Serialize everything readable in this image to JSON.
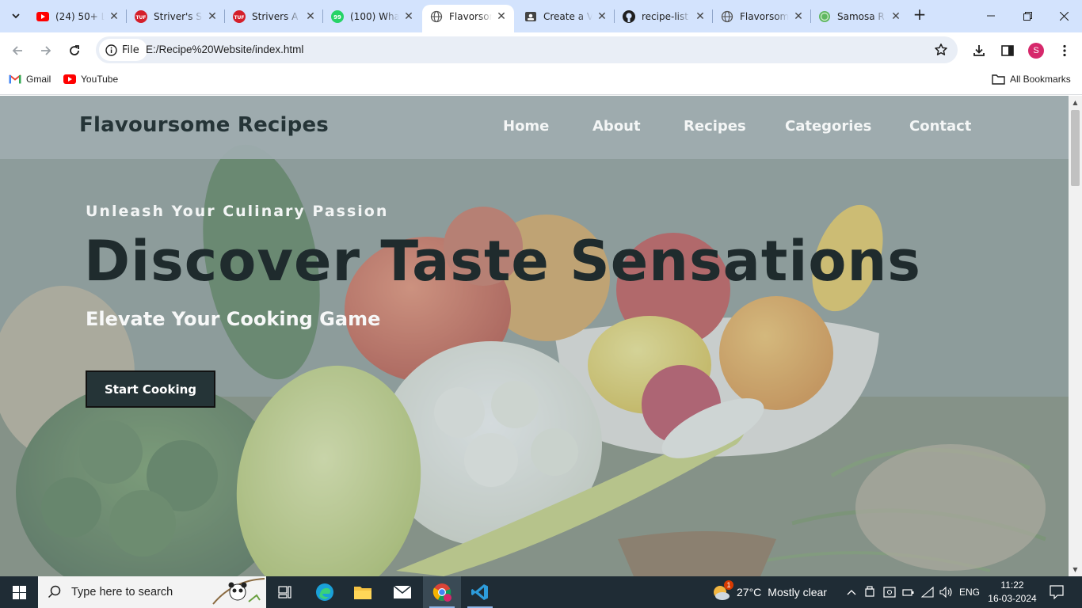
{
  "browser": {
    "tabs": [
      {
        "title": "(24) 50+ L",
        "icon": "youtube-icon"
      },
      {
        "title": "Striver's S",
        "icon": "tuf-icon"
      },
      {
        "title": "Strivers A",
        "icon": "tuf-icon"
      },
      {
        "title": "(100) Wha",
        "icon": "whatsapp-icon"
      },
      {
        "title": "Flavorsom",
        "icon": "globe-icon",
        "active": true
      },
      {
        "title": "Create a V",
        "icon": "contact-icon"
      },
      {
        "title": "recipe-list",
        "icon": "github-icon"
      },
      {
        "title": "Flavorsom",
        "icon": "globe-icon"
      },
      {
        "title": "Samosa R",
        "icon": "samosa-icon"
      }
    ],
    "address": {
      "chip_label": "File",
      "url": "E:/Recipe%20Website/index.html"
    },
    "profile_initial": "S",
    "bookmarks": [
      {
        "label": "Gmail",
        "icon": "gmail-icon"
      },
      {
        "label": "YouTube",
        "icon": "youtube-icon"
      }
    ],
    "all_bookmarks_label": "All Bookmarks"
  },
  "site": {
    "brand": "Flavoursome Recipes",
    "nav": [
      "Home",
      "About",
      "Recipes",
      "Categories",
      "Contact"
    ],
    "hero": {
      "kicker": "Unleash Your Culinary Passion",
      "headline": "Discover Taste Sensations",
      "subhead": "Elevate Your Cooking Game",
      "cta": "Start Cooking"
    }
  },
  "taskbar": {
    "search_placeholder": "Type here to search",
    "weather": {
      "temp": "27°C",
      "condition": "Mostly clear",
      "badge": "1"
    },
    "language": "ENG",
    "time": "11:22",
    "date": "16-03-2024"
  },
  "colors": {
    "tabstrip": "#d3e3fd",
    "nav_bar": "#a0acb0",
    "brand_text": "#253437",
    "cta_bg": "#253437",
    "taskbar": "#1f2c35"
  }
}
